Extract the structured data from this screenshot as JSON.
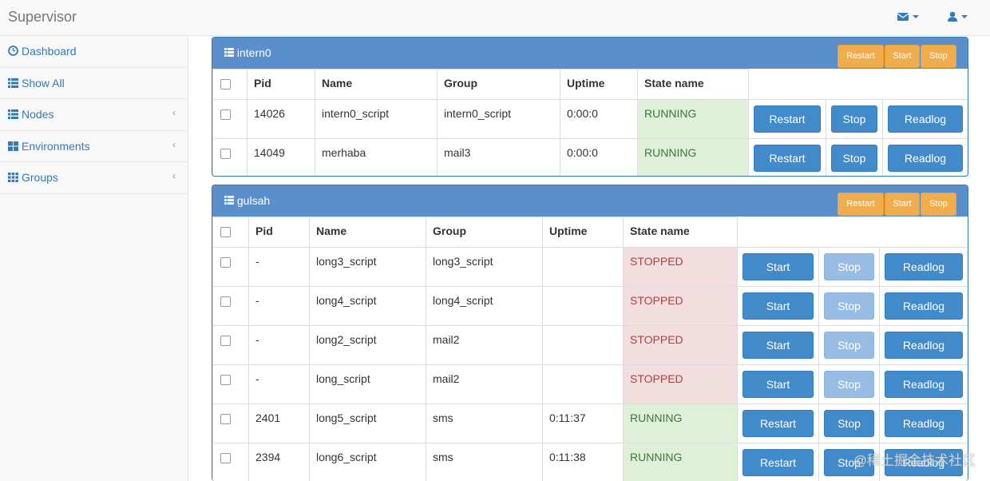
{
  "app": {
    "brand": "Supervisor"
  },
  "topbar": {
    "mail_icon": "envelope-icon",
    "user_icon": "user-icon"
  },
  "sidebar": {
    "items": [
      {
        "label": "Dashboard",
        "icon": "dashboard-icon",
        "has_chevron": false
      },
      {
        "label": "Show All",
        "icon": "list-icon",
        "has_chevron": false
      },
      {
        "label": "Nodes",
        "icon": "list-icon",
        "has_chevron": true
      },
      {
        "label": "Environments",
        "icon": "grid-icon",
        "has_chevron": true
      },
      {
        "label": "Groups",
        "icon": "grid-small-icon",
        "has_chevron": true
      }
    ]
  },
  "colors": {
    "accent": "#337ab7",
    "panel_header": "#5a8fcb",
    "warning": "#f0ad4e",
    "running_bg": "#dff0d8",
    "stopped_bg": "#f2dede"
  },
  "panels": [
    {
      "title": "intern0",
      "header_buttons": [
        "Restart",
        "Start",
        "Stop"
      ],
      "columns": [
        "Pid",
        "Name",
        "Group",
        "Uptime",
        "State name"
      ],
      "rows": [
        {
          "pid": "14026",
          "name": "intern0_script",
          "group": "intern0_script",
          "uptime": "0:00:0",
          "state": "RUNNING",
          "b1": "Restart",
          "b2": "Stop",
          "b3": "Readlog"
        },
        {
          "pid": "14049",
          "name": "merhaba",
          "group": "mail3",
          "uptime": "0:00:0",
          "state": "RUNNING",
          "b1": "Restart",
          "b2": "Stop",
          "b3": "Readlog"
        }
      ]
    },
    {
      "title": "gulsah",
      "header_buttons": [
        "Restart",
        "Start",
        "Stop"
      ],
      "columns": [
        "Pid",
        "Name",
        "Group",
        "Uptime",
        "State name"
      ],
      "rows": [
        {
          "pid": "-",
          "name": "long3_script",
          "group": "long3_script",
          "uptime": "",
          "state": "STOPPED",
          "b1": "Start",
          "b2": "Stop",
          "b3": "Readlog"
        },
        {
          "pid": "-",
          "name": "long4_script",
          "group": "long4_script",
          "uptime": "",
          "state": "STOPPED",
          "b1": "Start",
          "b2": "Stop",
          "b3": "Readlog"
        },
        {
          "pid": "-",
          "name": "long2_script",
          "group": "mail2",
          "uptime": "",
          "state": "STOPPED",
          "b1": "Start",
          "b2": "Stop",
          "b3": "Readlog"
        },
        {
          "pid": "-",
          "name": "long_script",
          "group": "mail2",
          "uptime": "",
          "state": "STOPPED",
          "b1": "Start",
          "b2": "Stop",
          "b3": "Readlog"
        },
        {
          "pid": "2401",
          "name": "long5_script",
          "group": "sms",
          "uptime": "0:11:37",
          "state": "RUNNING",
          "b1": "Restart",
          "b2": "Stop",
          "b3": "Readlog"
        },
        {
          "pid": "2394",
          "name": "long6_script",
          "group": "sms",
          "uptime": "0:11:38",
          "state": "RUNNING",
          "b1": "Restart",
          "b2": "Stop",
          "b3": "Readlog"
        }
      ]
    }
  ],
  "watermark": "@稀土掘金技术社区"
}
